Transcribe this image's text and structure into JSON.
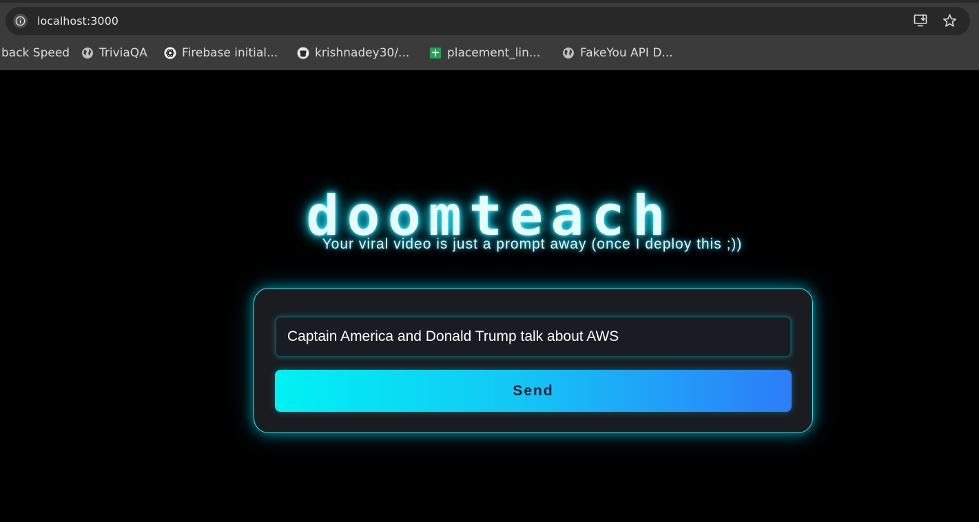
{
  "browser": {
    "url": "localhost:3000",
    "bookmarks": [
      {
        "label": "back Speed",
        "icon": "none"
      },
      {
        "label": "TriviaQA",
        "icon": "globe-icon"
      },
      {
        "label": "Firebase initial...",
        "icon": "openai-icon"
      },
      {
        "label": "krishnadey30/...",
        "icon": "github-icon"
      },
      {
        "label": "placement_lin...",
        "icon": "google-sheets-icon"
      },
      {
        "label": "FakeYou API D...",
        "icon": "globe-icon"
      }
    ]
  },
  "app": {
    "title": "doomteach",
    "tagline": "Your viral video is just a prompt away (once I deploy this ;))",
    "prompt": {
      "value": "Captain America and Donald Trump talk about AWS"
    },
    "send_label": "Send"
  },
  "colors": {
    "accent": "#2ee6f2",
    "button_start": "#00f2f3",
    "button_end": "#2d7cf9",
    "background": "#000000"
  }
}
